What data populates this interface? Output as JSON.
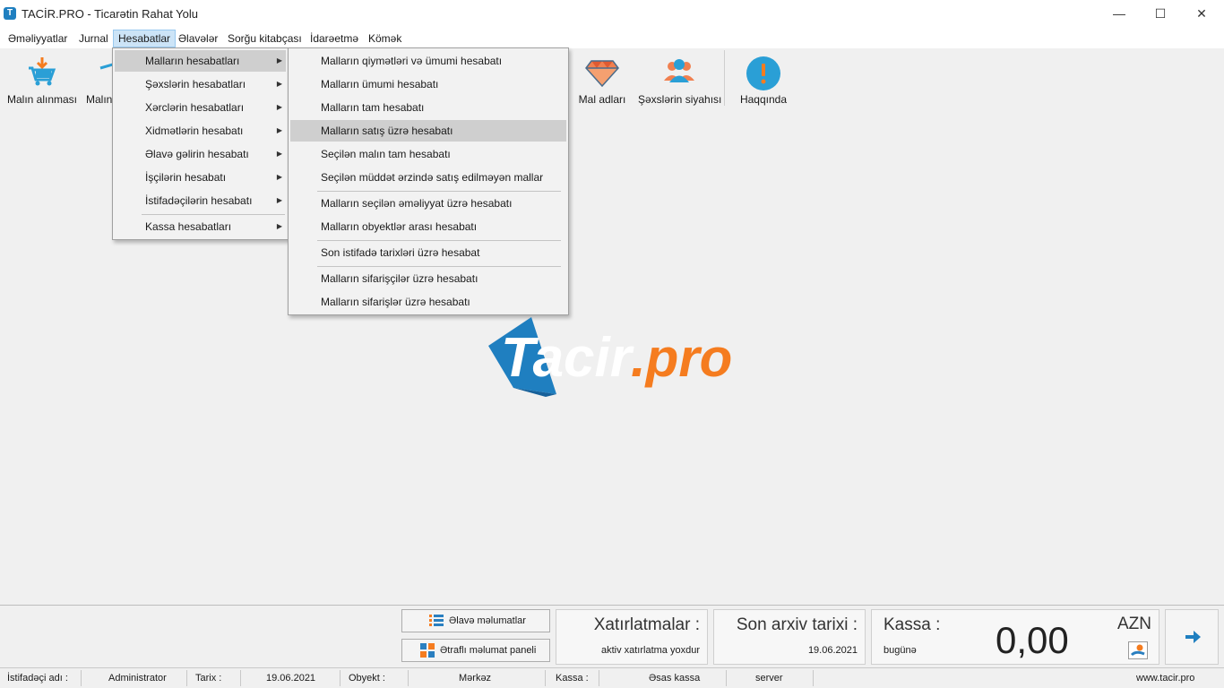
{
  "window": {
    "title": "TACİR.PRO - Ticarətin Rahat Yolu",
    "app_icon_letter": "T",
    "minimize": "—",
    "maximize": "☐",
    "close": "✕"
  },
  "menubar": [
    {
      "label": "Əməliyyatlar"
    },
    {
      "label": "Jurnal"
    },
    {
      "label": "Hesabatlar",
      "active": true
    },
    {
      "label": "Əlavələr"
    },
    {
      "label": "Sorğu kitabçası"
    },
    {
      "label": "İdarəetmə"
    },
    {
      "label": "Kömək"
    }
  ],
  "toolbar": {
    "purchase_label": "Malın alınması",
    "partial_label": "Malın",
    "goods_label": "Mal adları",
    "persons_label": "Şəxslərin siyahısı",
    "about_label": "Haqqında",
    "about_glyph": "!"
  },
  "reports_menu": [
    {
      "label": "Malların hesabatları"
    },
    {
      "label": "Şəxslərin hesabatları"
    },
    {
      "label": "Xərclərin hesabatları"
    },
    {
      "label": "Xidmətlərin hesabatı"
    },
    {
      "label": "Əlavə gəlirin hesabatı"
    },
    {
      "label": "İşçilərin hesabatı"
    },
    {
      "label": "İstifadəçilərin hesabatı"
    },
    {
      "label": "Kassa hesabatları"
    }
  ],
  "goods_submenu": [
    {
      "label": "Malların qiymətləri və ümumi hesabatı"
    },
    {
      "label": "Malların ümumi hesabatı"
    },
    {
      "label": "Malların tam hesabatı"
    },
    {
      "label": "Malların satış üzrə hesabatı"
    },
    {
      "label": "Seçilən malın tam hesabatı"
    },
    {
      "label": "Seçilən müddət ərzində satış edilməyən mallar"
    },
    {
      "label": "Malların seçilən əməliyyat üzrə hesabatı"
    },
    {
      "label": "Malların obyektlər arası hesabatı"
    },
    {
      "label": "Son istifadə tarixləri üzrə hesabat"
    },
    {
      "label": "Malların sifarişçilər üzrə hesabatı"
    },
    {
      "label": "Malların sifarişlər üzrə hesabatı"
    }
  ],
  "logo": {
    "part1": "Tacir",
    "part2": ".pro",
    "primary_color": "#1f7fc0",
    "accent_color": "#f57c1f"
  },
  "bottom": {
    "extra_info_button": "Əlavə məlumatlar",
    "detailed_panel_button": "Ətraflı məlumat paneli",
    "reminders_title": "Xatırlatmalar :",
    "reminders_status": "aktiv xatırlatma yoxdur",
    "archive_title": "Son arxiv tarixi :",
    "archive_date": "19.06.2021",
    "cash_title": "Kassa :",
    "cash_sub": "bugünə",
    "cash_amount": "0,00",
    "currency": "AZN"
  },
  "status": {
    "user_label": "İstifadəçi adı :",
    "user_value": "Administrator",
    "date_label": "Tarix :",
    "date_value": "19.06.2021",
    "object_label": "Obyekt :",
    "object_value": "Mərkəz",
    "cash_label": "Kassa :",
    "cash_value": "Əsas kassa",
    "server_value": "server",
    "website": "www.tacir.pro"
  }
}
